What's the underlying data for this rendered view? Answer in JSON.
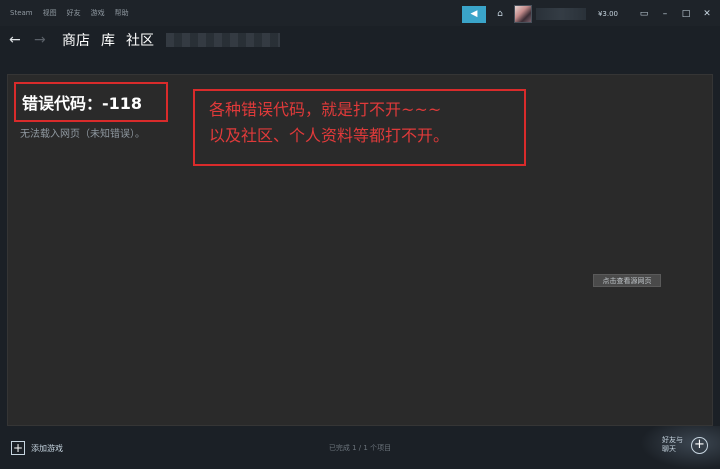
{
  "menubar": {
    "items": [
      "Steam",
      "视图",
      "好友",
      "游戏",
      "帮助"
    ],
    "balance": "¥3.00"
  },
  "nav": {
    "back_icon": "←",
    "forward_icon": "→",
    "links": [
      "商店",
      "库",
      "社区"
    ]
  },
  "page": {
    "error_title": "错误代码：-118",
    "error_subtitle": "无法载入网页（未知错误）。",
    "annotation_line1": "各种错误代码，就是打不开~~~",
    "annotation_line2": "以及社区、个人资料等都打不开。",
    "view_source_label": "点击查看源网页"
  },
  "footer": {
    "add_game_label": "添加游戏",
    "status_text": "已完成 1 / 1 个项目",
    "friends_label_line1": "好友与",
    "friends_label_line2": "聊天"
  },
  "colors": {
    "accent": "#3aa4c9",
    "annotation_red": "#d92b2b"
  }
}
